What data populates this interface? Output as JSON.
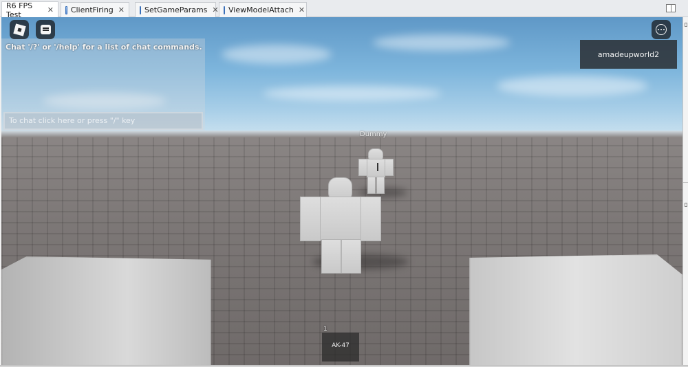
{
  "tabs": [
    {
      "label": "R6 FPS Test",
      "active": true,
      "icon": "none"
    },
    {
      "label": "ClientFiring",
      "active": false,
      "icon": "script-icon"
    },
    {
      "label": "SetGameParams",
      "active": false,
      "icon": "script-icon"
    },
    {
      "label": "ViewModelAttach",
      "active": false,
      "icon": "script-icon"
    }
  ],
  "tab_close_glyph": "✕",
  "chat": {
    "system_message": "Chat '/?' or '/help' for a list of chat commands.",
    "input_placeholder": "To chat click here or press \"/\" key"
  },
  "player_list": {
    "players": [
      "amadeupworld2"
    ]
  },
  "world": {
    "npc_name": "Dummy"
  },
  "hotbar": {
    "slots": [
      {
        "number": "1",
        "label": "AK-47"
      }
    ]
  },
  "colors": {
    "sky_top": "#5f98c7",
    "ground": "#7c7776",
    "character": "#d4d4d4"
  }
}
